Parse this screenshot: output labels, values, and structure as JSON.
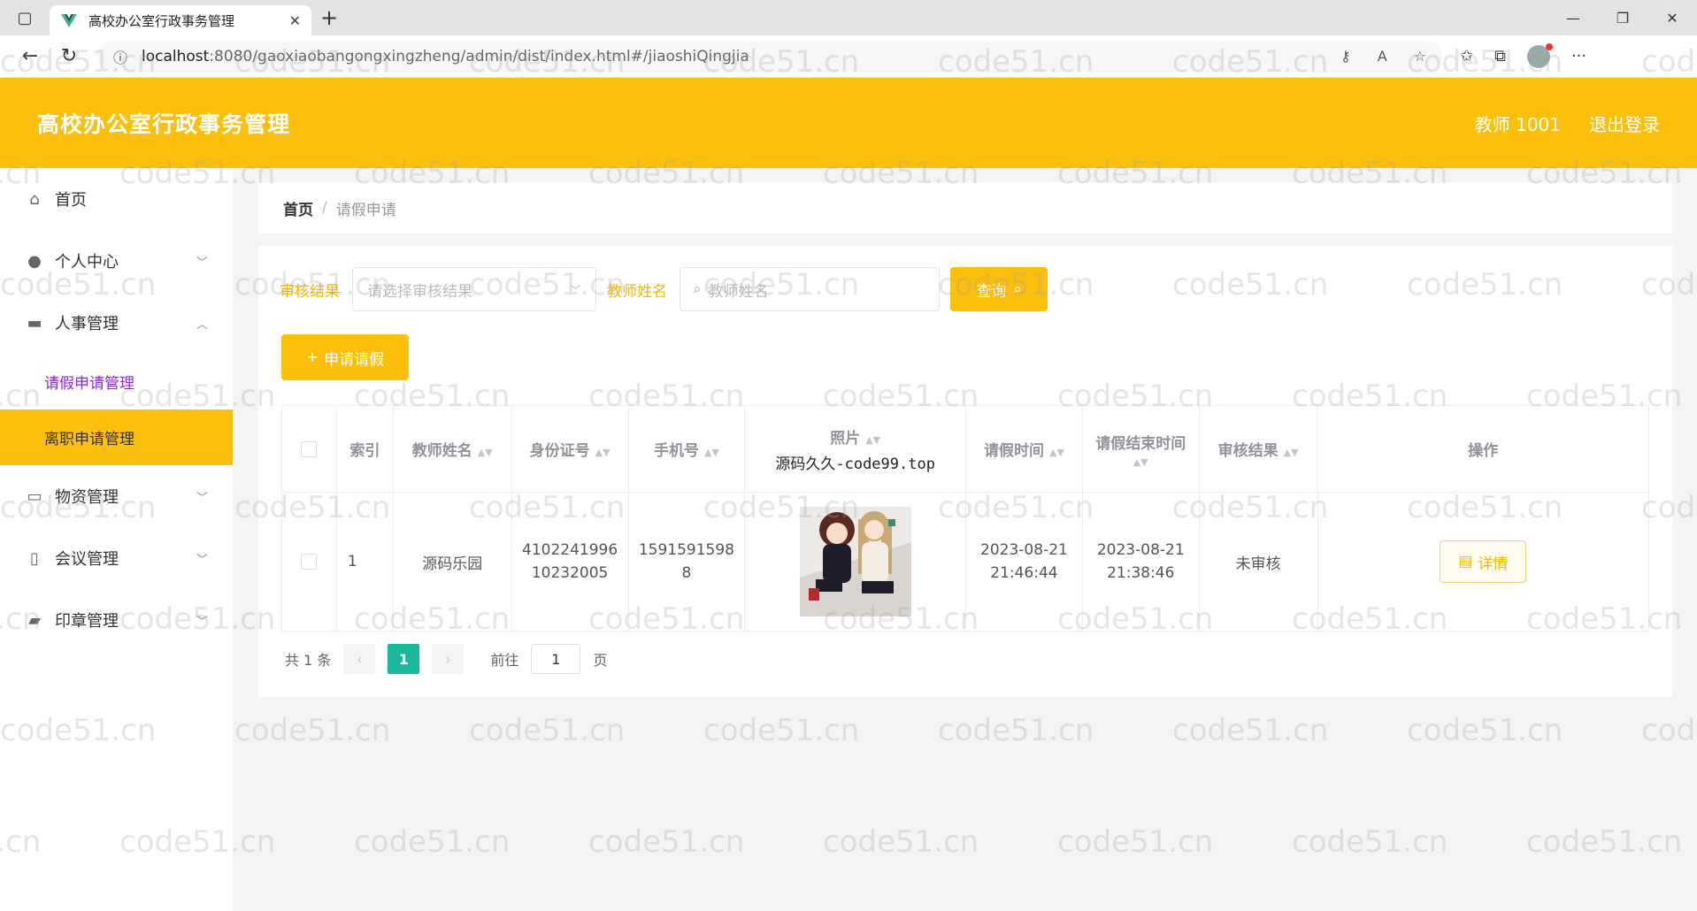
{
  "browser": {
    "tab_title": "高校办公室行政事务管理",
    "url_host": "localhost",
    "url_path": ":8080/gaoxiaobangongxingzheng/admin/dist/index.html#/jiaoshiQingjia"
  },
  "header": {
    "title": "高校办公室行政事务管理",
    "user": "教师 1001",
    "logout": "退出登录"
  },
  "sidebar": {
    "items": [
      {
        "label": "首页",
        "icon": "home-icon"
      },
      {
        "label": "个人中心",
        "icon": "user-icon"
      },
      {
        "label": "人事管理",
        "icon": "briefcase-icon"
      },
      {
        "label": "物资管理",
        "icon": "box-icon"
      },
      {
        "label": "会议管理",
        "icon": "meeting-icon"
      },
      {
        "label": "印章管理",
        "icon": "stamp-icon"
      }
    ],
    "sub": {
      "leave": "请假申请管理",
      "resign": "离职申请管理"
    }
  },
  "breadcrumb": {
    "home": "首页",
    "sep": "/",
    "current": "请假申请"
  },
  "filters": {
    "status_label": "审核结果",
    "status_placeholder": "请选择审核结果",
    "name_label": "教师姓名",
    "name_placeholder": "教师姓名",
    "query_btn": "查询"
  },
  "add_btn": "申请请假",
  "table": {
    "headers": {
      "index": "索引",
      "name": "教师姓名",
      "idcard": "身份证号",
      "phone": "手机号",
      "photo": "照片",
      "photo_sub": "源码久久-code99.top",
      "start": "请假时间",
      "end": "请假结束时间",
      "status": "审核结果",
      "ops": "操作"
    },
    "rows": [
      {
        "index": "1",
        "name": "源码乐园",
        "idcard_1": "4102241996",
        "idcard_2": "10232005",
        "phone_1": "1591591598",
        "phone_2": "8",
        "start_date": "2023-08-21",
        "start_time": "21:46:44",
        "end_date": "2023-08-21",
        "end_time": "21:38:46",
        "status": "未审核",
        "detail": "详情"
      }
    ]
  },
  "pager": {
    "total": "共 1 条",
    "page": "1",
    "goto": "前往",
    "goto_value": "1",
    "unit": "页"
  },
  "watermark": "code51.cn"
}
